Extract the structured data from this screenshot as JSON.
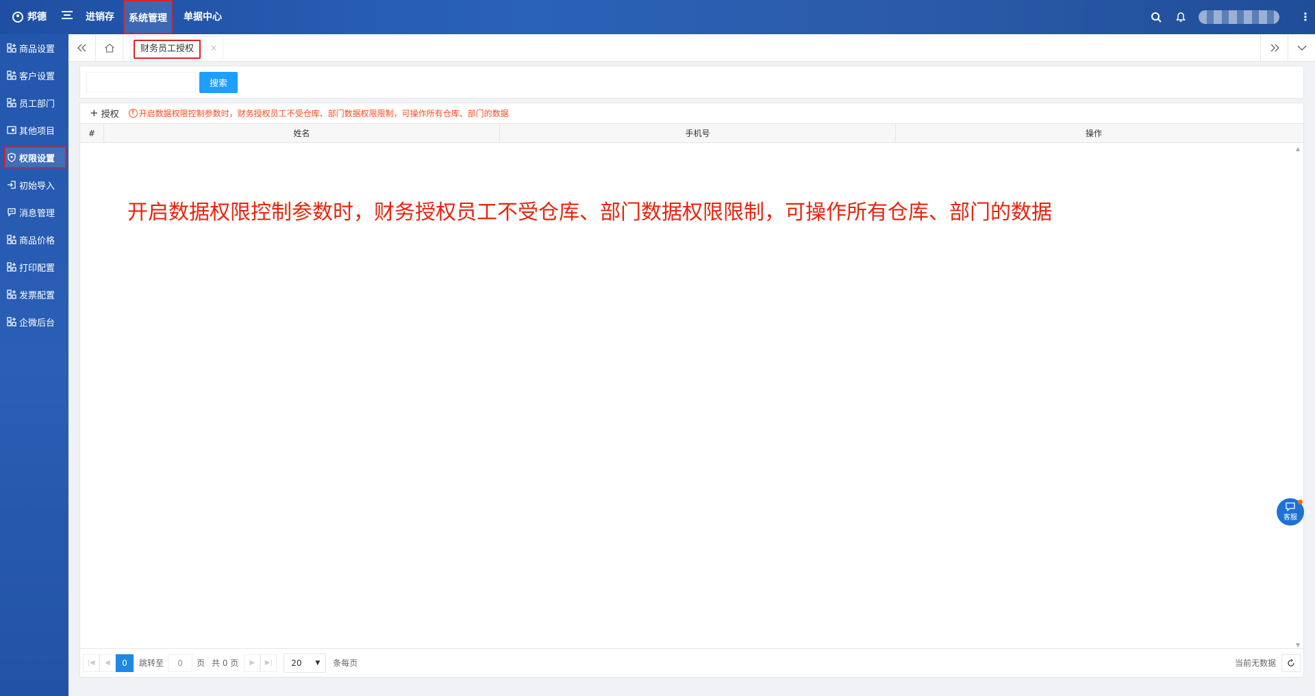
{
  "topbar": {
    "brand": "邦德",
    "nav": [
      "进销存",
      "系统管理",
      "单据中心"
    ]
  },
  "sidebar": {
    "items": [
      {
        "label": "商品设置",
        "icon": "grid-plus-icon"
      },
      {
        "label": "客户设置",
        "icon": "grid-plus-icon"
      },
      {
        "label": "员工部门",
        "icon": "grid-plus-icon"
      },
      {
        "label": "其他项目",
        "icon": "card-icon"
      },
      {
        "label": "权限设置",
        "icon": "shield-icon"
      },
      {
        "label": "初始导入",
        "icon": "import-icon"
      },
      {
        "label": "消息管理",
        "icon": "message-icon"
      },
      {
        "label": "商品价格",
        "icon": "grid-plus-icon"
      },
      {
        "label": "打印配置",
        "icon": "grid-plus-icon"
      },
      {
        "label": "发票配置",
        "icon": "grid-plus-icon"
      },
      {
        "label": "企微后台",
        "icon": "grid-plus-icon"
      }
    ]
  },
  "tabs": {
    "active_label": "财务员工授权",
    "close": "×"
  },
  "search": {
    "placeholder": "",
    "button": "搜索"
  },
  "toolbar": {
    "grant_label": "授权",
    "notice": "开启数据权限控制参数时，财务授权员工不受仓库、部门数据权限限制，可操作所有仓库、部门的数据"
  },
  "table": {
    "columns": [
      "#",
      "姓名",
      "手机号",
      "操作"
    ]
  },
  "annotation": "开启数据权限控制参数时，财务授权员工不受仓库、部门数据权限限制，可操作所有仓库、部门的数据",
  "pager": {
    "current": "0",
    "jump_label": "跳转至",
    "jump_value": "0",
    "page_label": "页",
    "total_label": "共 0 页",
    "page_size": "20",
    "per_page_label": "条每页",
    "empty_label": "当前无数据"
  },
  "kefu": "客服",
  "colors": {
    "accent": "#1e9fff",
    "highlight": "#e02020",
    "notice": "#ff4a1a",
    "annotation": "#e8230c"
  }
}
